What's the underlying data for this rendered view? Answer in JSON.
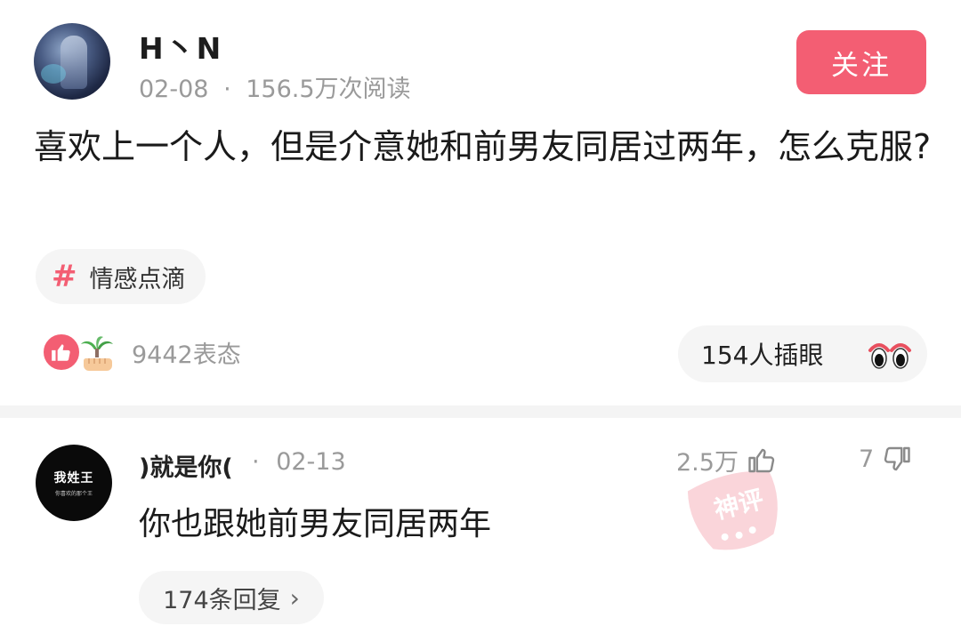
{
  "post": {
    "author": "H丶N",
    "date": "02-08",
    "separator": "·",
    "views": "156.5万次阅读",
    "follow_label": "关注",
    "question": "喜欢上一个人，但是介意她和前男友同居过两年，怎么克服?",
    "topic_hash": "#",
    "topic_label": "情感点滴",
    "reaction_count": "9442表态",
    "peek_label": "154人插眼"
  },
  "comment": {
    "avatar_text": "我姓王",
    "avatar_subtext": "你喜欢的那个王",
    "username": ")就是你(",
    "separator": "·",
    "date": "02-13",
    "like_count": "2.5万",
    "dislike_count": "7",
    "text": "你也跟她前男友同居两年",
    "replies_label": "174条回复",
    "stamp_text": "神评"
  },
  "colors": {
    "accent": "#f35e73",
    "muted_text": "#9a9a9a",
    "chip_bg": "#f5f5f5"
  }
}
